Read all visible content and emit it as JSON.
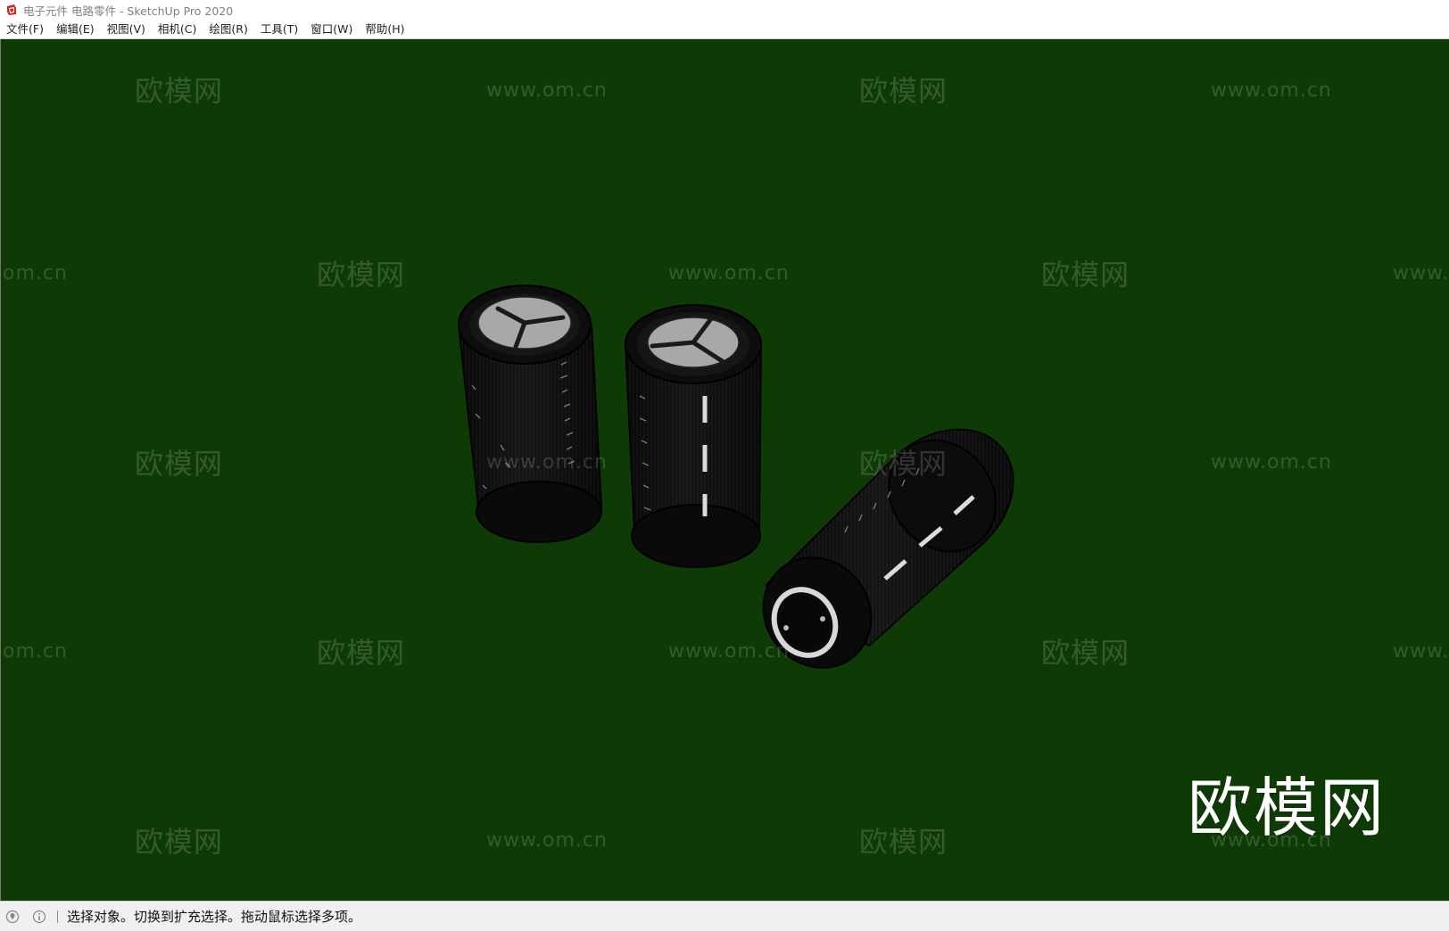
{
  "window": {
    "title": "电子元件 电路零件 - SketchUp Pro 2020"
  },
  "menubar": {
    "items": [
      {
        "label": "文件(F)"
      },
      {
        "label": "编辑(E)"
      },
      {
        "label": "视图(V)"
      },
      {
        "label": "相机(C)"
      },
      {
        "label": "绘图(R)"
      },
      {
        "label": "工具(T)"
      },
      {
        "label": "窗口(W)"
      },
      {
        "label": "帮助(H)"
      }
    ]
  },
  "viewport": {
    "background_color": "#0e3b05",
    "model_color": "#0b0b0b",
    "cap_color": "#a8a8a8",
    "watermarks": {
      "cn_text": "欧模网",
      "url_text": "www.om.cn",
      "url_cut_left": "om.cn",
      "url_cut_right": "www."
    },
    "logo_text": "欧模网"
  },
  "statusbar": {
    "icons": [
      "geo-location-icon",
      "credits-info-icon"
    ],
    "message": "选择对象。切换到扩充选择。拖动鼠标选择多项。"
  }
}
